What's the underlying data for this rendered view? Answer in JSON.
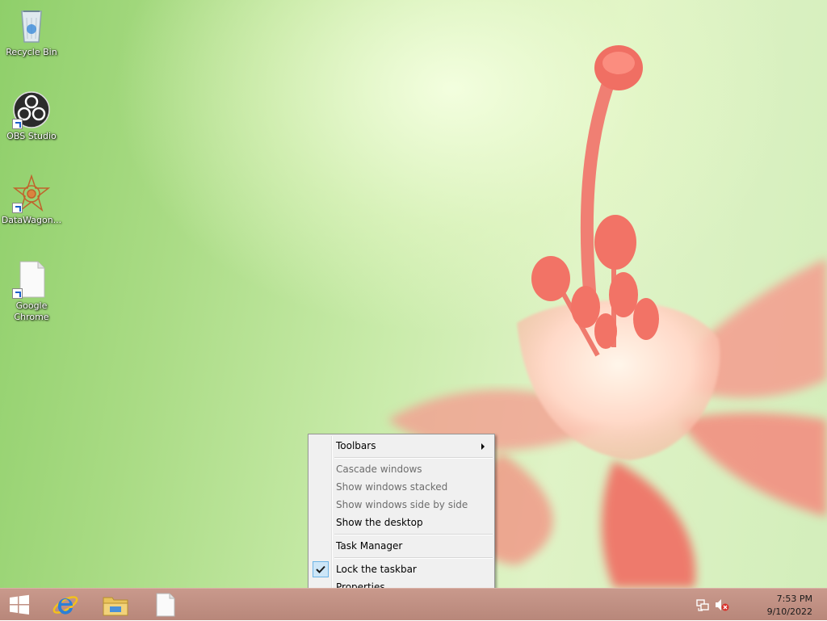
{
  "desktop": {
    "icons": [
      {
        "label": "Recycle Bin",
        "icon": "recycle-bin-icon"
      },
      {
        "label": "OBS Studio",
        "icon": "obs-studio-icon"
      },
      {
        "label": "DataWagon...",
        "icon": "datawagon-icon"
      },
      {
        "label": "Google Chrome",
        "icon": "file-icon"
      }
    ]
  },
  "context_menu": {
    "items": [
      {
        "label": "Toolbars",
        "enabled": true,
        "submenu": true
      },
      {
        "label": "Cascade windows",
        "enabled": false
      },
      {
        "label": "Show windows stacked",
        "enabled": false
      },
      {
        "label": "Show windows side by side",
        "enabled": false
      },
      {
        "label": "Show the desktop",
        "enabled": true
      },
      {
        "label": "Task Manager",
        "enabled": true
      },
      {
        "label": "Lock the taskbar",
        "enabled": true,
        "checked": true
      },
      {
        "label": "Properties",
        "enabled": true
      }
    ]
  },
  "taskbar": {
    "pinned": [
      {
        "icon": "windows-start-icon"
      },
      {
        "icon": "internet-explorer-icon"
      },
      {
        "icon": "file-explorer-icon"
      },
      {
        "icon": "blank-document-icon"
      }
    ],
    "tray": [
      {
        "icon": "network-icon"
      },
      {
        "icon": "volume-muted-icon"
      }
    ],
    "clock": {
      "time": "7:53 PM",
      "date": "9/10/2022"
    }
  },
  "colors": {
    "taskbar": "#c0907f",
    "menu_background": "#f0f0f0",
    "check_highlight": "#cde6f7"
  }
}
